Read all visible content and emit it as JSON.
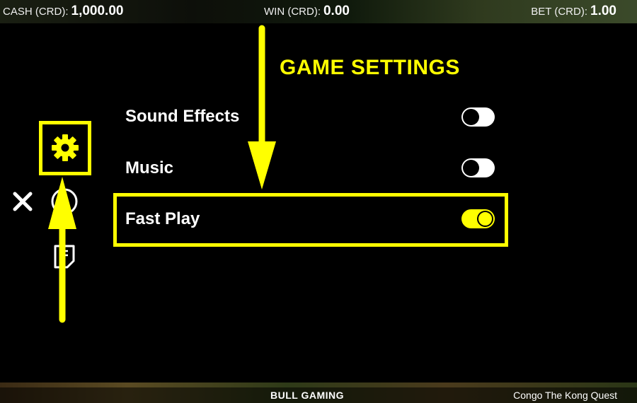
{
  "header": {
    "cash": {
      "label": "CASH (CRD):",
      "value": "1,000.00"
    },
    "win": {
      "label": "WIN (CRD):",
      "value": "0.00"
    },
    "bet": {
      "label": "BET (CRD):",
      "value": "1.00"
    }
  },
  "settings": {
    "title": "GAME SETTINGS",
    "items": [
      {
        "label": "Sound Effects",
        "enabled": false
      },
      {
        "label": "Music",
        "enabled": false
      },
      {
        "label": "Fast Play",
        "enabled": true
      }
    ]
  },
  "sidebar": {
    "icons": [
      "gear-icon",
      "close-icon",
      "info-icon",
      "paytable-icon"
    ]
  },
  "footer": {
    "brand": "BULL GAMING",
    "game_title": "Congo The Kong Quest"
  },
  "colors": {
    "highlight": "#ffff00",
    "background": "#000000",
    "text": "#ffffff"
  }
}
